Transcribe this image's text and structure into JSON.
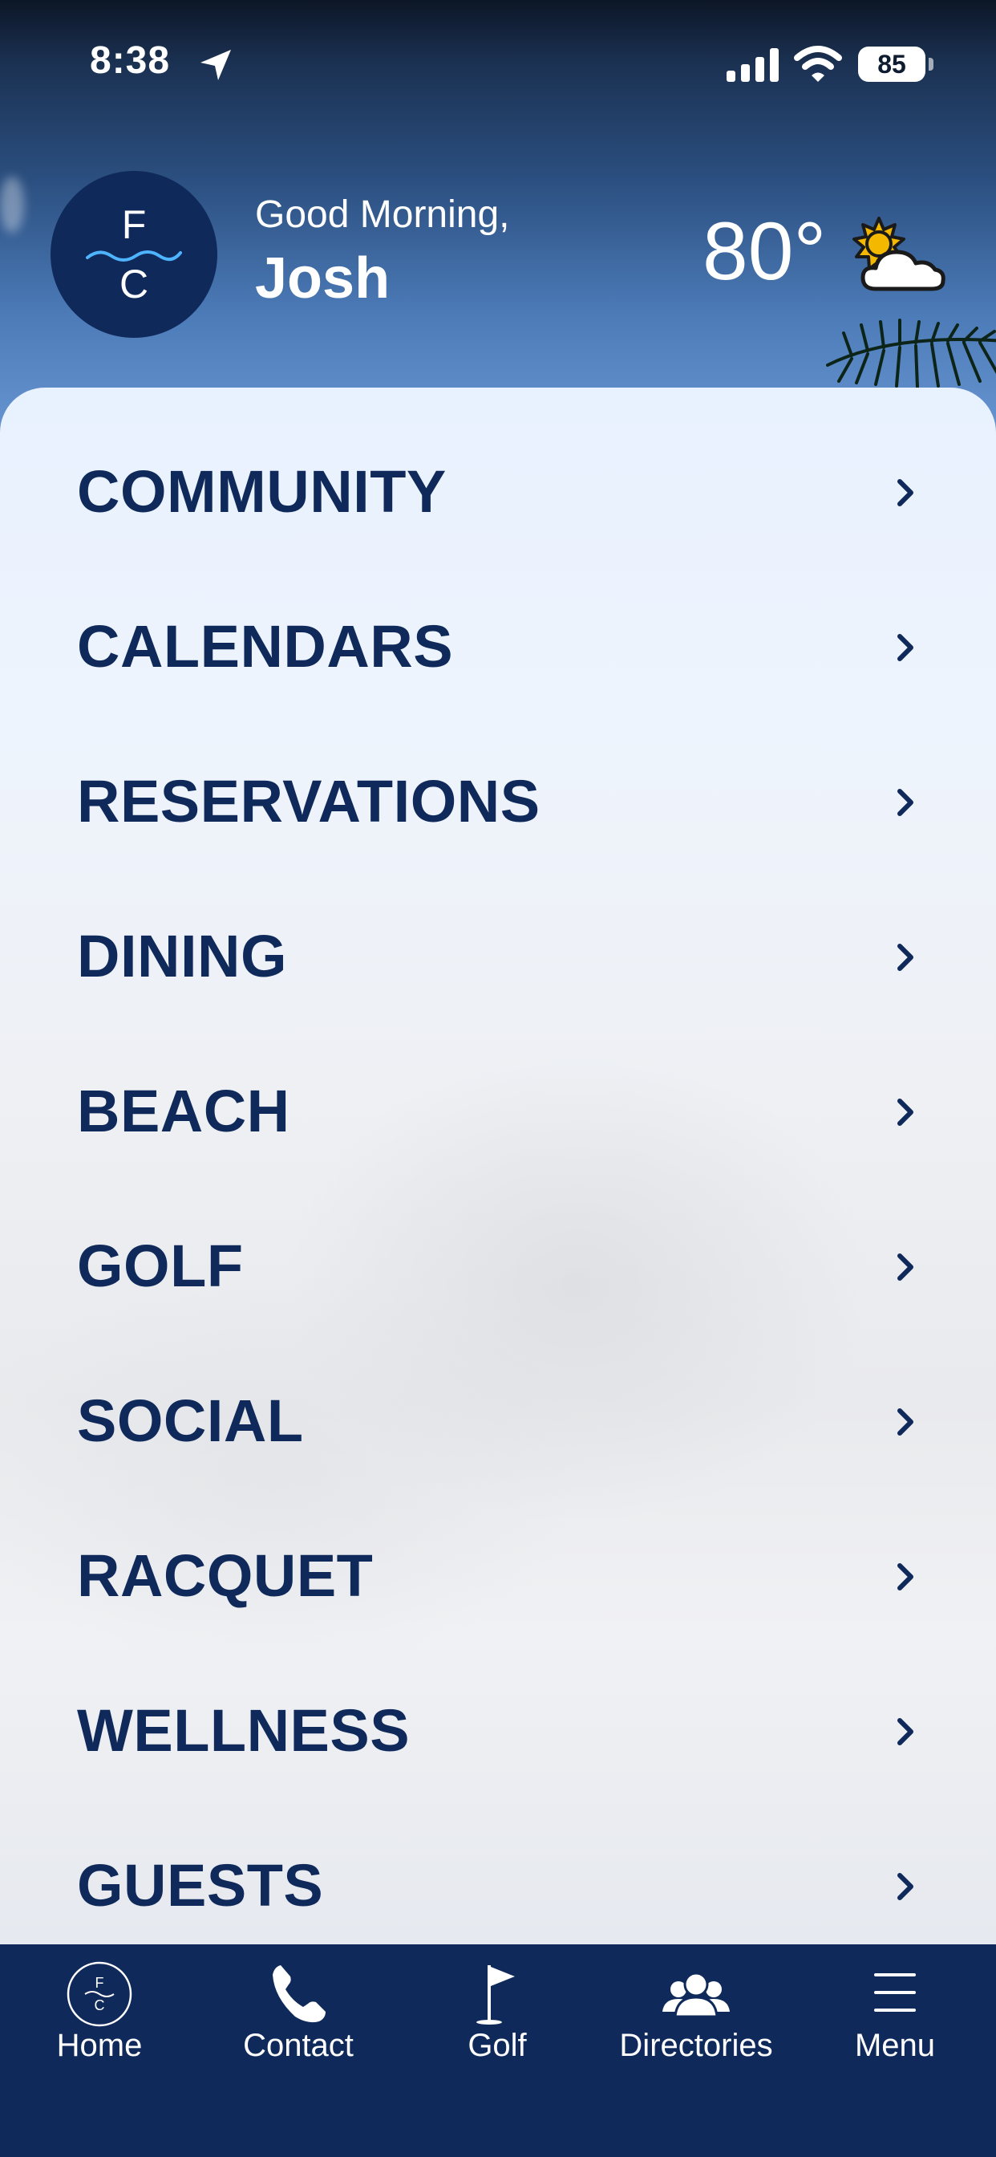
{
  "status_bar": {
    "time": "8:38",
    "battery": "85"
  },
  "header": {
    "logo_letters": [
      "F",
      "C"
    ],
    "greeting": "Good Morning,",
    "user_name": "Josh",
    "temperature": "80°",
    "weather_icon": "partly-sunny-icon"
  },
  "menu": {
    "items": [
      {
        "label": "COMMUNITY"
      },
      {
        "label": "CALENDARS"
      },
      {
        "label": "RESERVATIONS"
      },
      {
        "label": "DINING"
      },
      {
        "label": "BEACH"
      },
      {
        "label": "GOLF"
      },
      {
        "label": "SOCIAL"
      },
      {
        "label": "RACQUET"
      },
      {
        "label": "WELLNESS"
      },
      {
        "label": "GUESTS"
      }
    ]
  },
  "tab_bar": {
    "tabs": [
      {
        "label": "Home",
        "icon": "club-logo-icon"
      },
      {
        "label": "Contact",
        "icon": "phone-icon"
      },
      {
        "label": "Golf",
        "icon": "golf-flag-icon"
      },
      {
        "label": "Directories",
        "icon": "people-icon"
      },
      {
        "label": "Menu",
        "icon": "hamburger-icon"
      }
    ]
  },
  "colors": {
    "brand_navy": "#0f2a5a",
    "text_white": "#ffffff",
    "sun_yellow": "#f5b800"
  }
}
